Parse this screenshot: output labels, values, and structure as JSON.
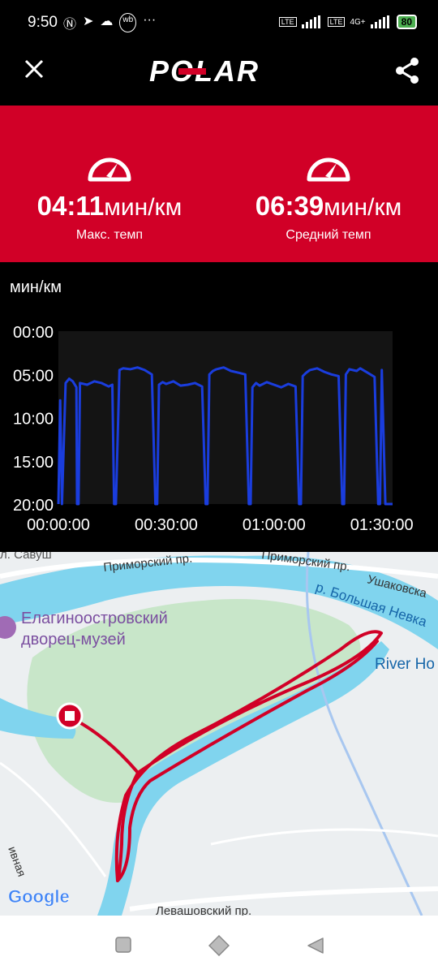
{
  "status_bar": {
    "time": "9:50",
    "left_icons": [
      "nfc-icon",
      "telegram-icon",
      "cloud-icon",
      "wb-icon",
      "more-icon"
    ],
    "right_icons": [
      "volte-icon",
      "signal-icon",
      "volte-icon",
      "4g-signal-icon"
    ],
    "network": "4G+",
    "battery": "80"
  },
  "app_bar": {
    "logo": "POLAR",
    "close_icon": "close-icon",
    "share_icon": "share-icon"
  },
  "stats": {
    "max_pace": {
      "value": "04:11",
      "unit": "мин/км",
      "label": "Макс. темп"
    },
    "avg_pace": {
      "value": "06:39",
      "unit": "мин/км",
      "label": "Средний темп"
    }
  },
  "chart_data": {
    "type": "line",
    "ylabel": "мин/км",
    "y_ticks": [
      "00:00",
      "05:00",
      "10:00",
      "15:00",
      "20:00"
    ],
    "x_ticks": [
      "00:00:00",
      "00:30:00",
      "01:00:00",
      "01:30:00"
    ],
    "ylim": [
      0,
      20
    ],
    "y_inverted": true,
    "xlim": [
      0,
      93
    ],
    "series_color": "#1a3ddd",
    "series": [
      {
        "x": [
          0,
          0.5,
          1,
          2,
          3,
          4,
          5,
          5.2,
          5.6,
          6,
          8,
          10,
          12,
          14,
          15,
          15.5,
          16,
          17,
          18,
          20,
          22,
          24,
          26,
          27,
          27.5,
          28,
          29,
          30,
          32,
          34,
          36,
          38,
          40,
          41,
          41.5,
          42,
          43,
          44,
          46,
          48,
          50,
          52,
          53,
          53.5,
          54,
          55,
          56,
          58,
          60,
          62,
          64,
          66,
          67,
          67.5,
          68,
          69,
          70,
          72,
          74,
          76,
          78,
          79,
          79.5,
          80,
          81,
          83,
          84,
          86,
          88,
          89,
          89.5,
          90,
          91,
          93
        ],
        "y": [
          20,
          8,
          20,
          6,
          5.5,
          5.8,
          6.5,
          20,
          20,
          6,
          6.2,
          5.8,
          6,
          6.4,
          6.2,
          20,
          20,
          4.5,
          4.3,
          4.4,
          4.2,
          4.5,
          5,
          20,
          20,
          6.2,
          5.9,
          6.1,
          5.8,
          6.3,
          6.2,
          6,
          6.4,
          20,
          20,
          5,
          4.6,
          4.4,
          4.2,
          4.6,
          4.8,
          5,
          20,
          20,
          6.5,
          6,
          6.3,
          5.9,
          6.2,
          6.5,
          6.1,
          6.4,
          20,
          20,
          5.2,
          4.8,
          4.5,
          4.3,
          4.7,
          5,
          5.2,
          20,
          20,
          5,
          4.4,
          4.6,
          4.3,
          4.8,
          5.3,
          20,
          20,
          4.5,
          20,
          20
        ]
      }
    ]
  },
  "map": {
    "labels": {
      "street_top_left": "л. Савуш",
      "primorsky_1": "Приморский пр.",
      "primorsky_2": "Приморский пр.",
      "ushakovskaya": "Ушаковска",
      "bolshaya_nevka": "р. Большая Невка",
      "palace_line1": "Елагиноостровский",
      "palace_line2": "дворец-музей",
      "river_house": "River Ho",
      "levashovsky": "Левашовский пр.",
      "vertical_street": "ивная"
    },
    "google": "Google",
    "route_color": "#d10027",
    "water_color": "#7fd0ea",
    "park_color": "#c8e6c9"
  },
  "nav_bar": {
    "recents_icon": "square-icon",
    "home_icon": "diamond-icon",
    "back_icon": "triangle-back-icon"
  }
}
